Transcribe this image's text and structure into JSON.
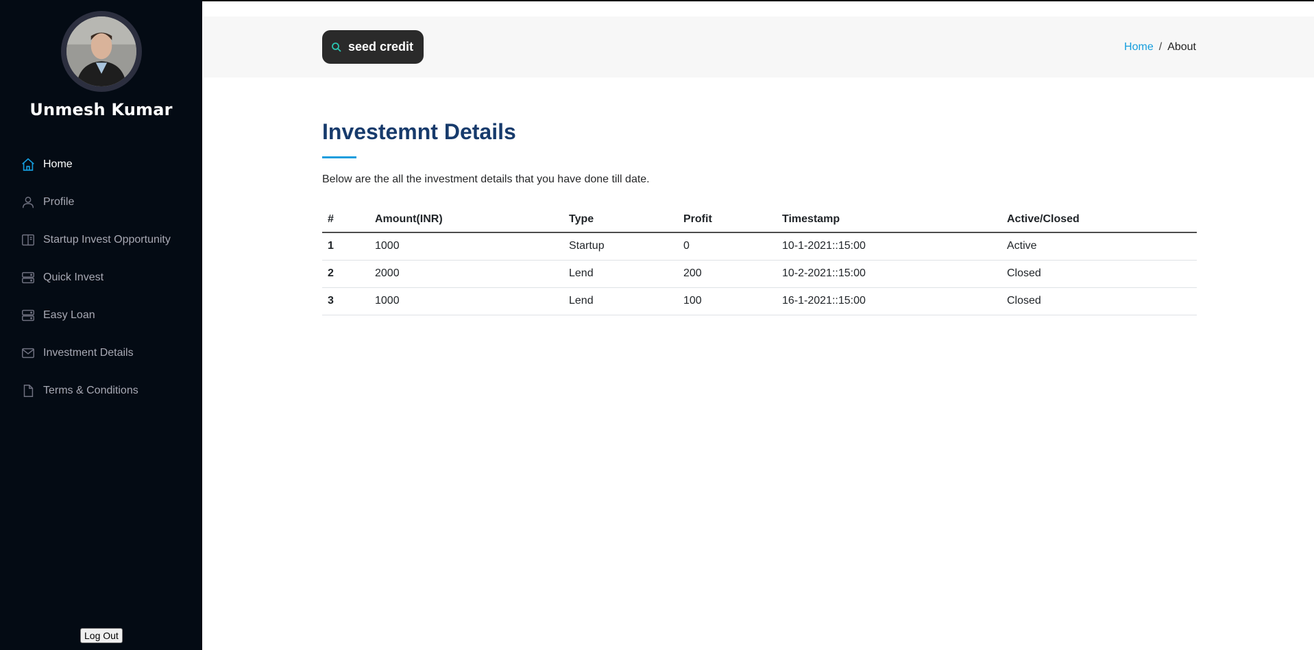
{
  "sidebar": {
    "username": "Unmesh Kumar",
    "items": [
      {
        "label": "Home",
        "icon": "home-icon",
        "active": true
      },
      {
        "label": "Profile",
        "icon": "person-icon"
      },
      {
        "label": "Startup Invest Opportunity",
        "icon": "book-icon"
      },
      {
        "label": "Quick Invest",
        "icon": "server-icon"
      },
      {
        "label": "Easy Loan",
        "icon": "server-icon"
      },
      {
        "label": "Investment Details",
        "icon": "envelope-icon"
      },
      {
        "label": "Terms & Conditions",
        "icon": "file-icon"
      }
    ],
    "logout_label": "Log Out"
  },
  "header": {
    "brand_label": "seed credit",
    "breadcrumb": {
      "home": "Home",
      "separator": "/",
      "current": "About"
    }
  },
  "main": {
    "title": "Investemnt Details",
    "intro": "Below are the all the investment details that you have done till date.",
    "table": {
      "headers": [
        "#",
        "Amount(INR)",
        "Type",
        "Profit",
        "Timestamp",
        "Active/Closed"
      ],
      "rows": [
        [
          "1",
          "1000",
          "Startup",
          "0",
          "10-1-2021::15:00",
          "Active"
        ],
        [
          "2",
          "2000",
          "Lend",
          "200",
          "10-2-2021::15:00",
          "Closed"
        ],
        [
          "3",
          "1000",
          "Lend",
          "100",
          "16-1-2021::15:00",
          "Closed"
        ]
      ]
    }
  },
  "colors": {
    "sidebar_bg": "#040b14",
    "accent": "#149ddd",
    "title": "#173b6c"
  }
}
